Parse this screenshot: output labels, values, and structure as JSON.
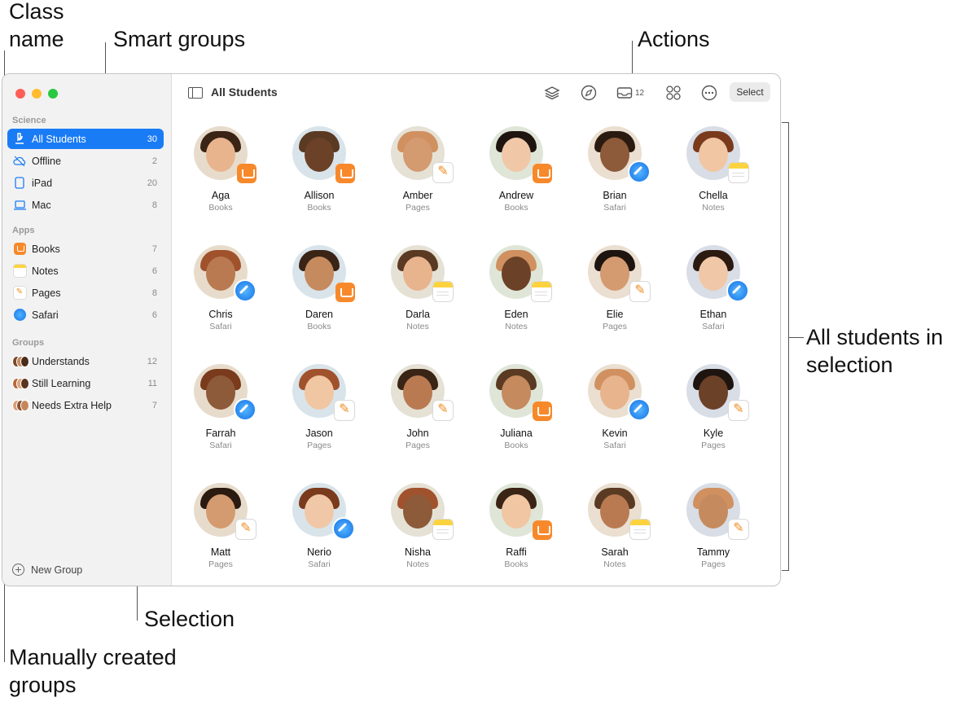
{
  "callouts": {
    "class_name": "Class\nname",
    "smart_groups": "Smart groups",
    "actions": "Actions",
    "all_students": "All students in\nselection",
    "selection": "Selection",
    "manual_groups": "Manually created\ngroups"
  },
  "sidebar": {
    "class_title": "Science",
    "smart_items": [
      {
        "label": "All Students",
        "count": "30",
        "icon": "microscope-icon"
      },
      {
        "label": "Offline",
        "count": "2",
        "icon": "offline-cloud-icon"
      },
      {
        "label": "iPad",
        "count": "20",
        "icon": "ipad-icon"
      },
      {
        "label": "Mac",
        "count": "8",
        "icon": "laptop-icon"
      }
    ],
    "apps_title": "Apps",
    "app_items": [
      {
        "label": "Books",
        "count": "7",
        "icon": "books-app-icon"
      },
      {
        "label": "Notes",
        "count": "6",
        "icon": "notes-app-icon"
      },
      {
        "label": "Pages",
        "count": "8",
        "icon": "pages-app-icon"
      },
      {
        "label": "Safari",
        "count": "6",
        "icon": "safari-app-icon"
      }
    ],
    "groups_title": "Groups",
    "group_items": [
      {
        "label": "Understands",
        "count": "12"
      },
      {
        "label": "Still Learning",
        "count": "11"
      },
      {
        "label": "Needs Extra Help",
        "count": "7"
      }
    ],
    "new_group": "New Group"
  },
  "toolbar": {
    "title": "All Students",
    "inbox_count": "12",
    "select_label": "Select"
  },
  "students": [
    {
      "name": "Aga",
      "app": "Books"
    },
    {
      "name": "Allison",
      "app": "Books"
    },
    {
      "name": "Amber",
      "app": "Pages"
    },
    {
      "name": "Andrew",
      "app": "Books"
    },
    {
      "name": "Brian",
      "app": "Safari"
    },
    {
      "name": "Chella",
      "app": "Notes"
    },
    {
      "name": "Chris",
      "app": "Safari"
    },
    {
      "name": "Daren",
      "app": "Books"
    },
    {
      "name": "Darla",
      "app": "Notes"
    },
    {
      "name": "Eden",
      "app": "Notes"
    },
    {
      "name": "Elie",
      "app": "Pages"
    },
    {
      "name": "Ethan",
      "app": "Safari"
    },
    {
      "name": "Farrah",
      "app": "Safari"
    },
    {
      "name": "Jason",
      "app": "Pages"
    },
    {
      "name": "John",
      "app": "Pages"
    },
    {
      "name": "Juliana",
      "app": "Books"
    },
    {
      "name": "Kevin",
      "app": "Safari"
    },
    {
      "name": "Kyle",
      "app": "Pages"
    },
    {
      "name": "Matt",
      "app": "Pages"
    },
    {
      "name": "Nerio",
      "app": "Safari"
    },
    {
      "name": "Nisha",
      "app": "Notes"
    },
    {
      "name": "Raffi",
      "app": "Books"
    },
    {
      "name": "Sarah",
      "app": "Notes"
    },
    {
      "name": "Tammy",
      "app": "Pages"
    }
  ],
  "colors": {
    "accent": "#1a7cf5",
    "books": "#f7892b",
    "notes": "#fcd33f",
    "pages": "#f08d22",
    "safari": "#1673e6"
  }
}
